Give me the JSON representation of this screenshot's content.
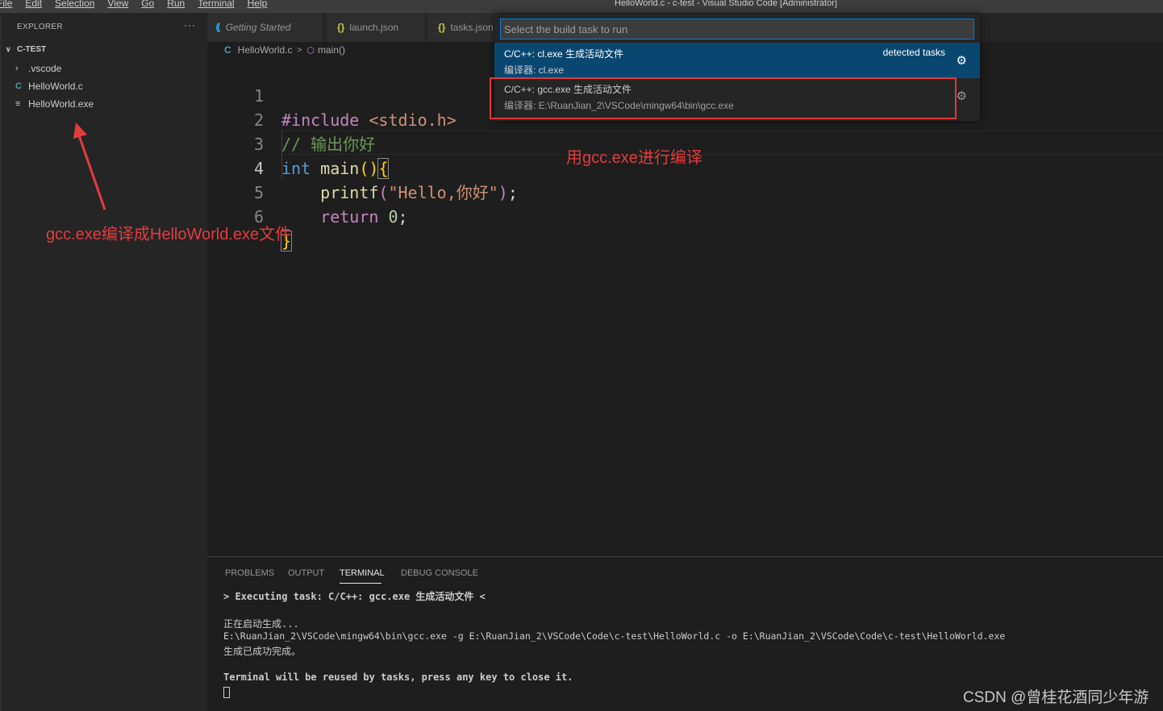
{
  "menu": [
    "File",
    "Edit",
    "Selection",
    "View",
    "Go",
    "Run",
    "Terminal",
    "Help"
  ],
  "window_title": "HelloWorld.c - c-test - Visual Studio Code [Administrator]",
  "explorer": {
    "header": "EXPLORER",
    "more": "···",
    "root": "C-TEST",
    "items": [
      {
        "icon": "chevron-right-icon",
        "label": ".vscode"
      },
      {
        "icon": "c-file-icon",
        "label": "HelloWorld.c"
      },
      {
        "icon": "exe-file-icon",
        "label": "HelloWorld.exe"
      }
    ]
  },
  "tabs": [
    {
      "label": "Getting Started",
      "icon": "vscode-icon"
    },
    {
      "label": "launch.json",
      "icon": "json-icon"
    },
    {
      "label": "tasks.json",
      "icon": "json-icon"
    }
  ],
  "breadcrumb": {
    "file": "HelloWorld.c",
    "symbol": "main()"
  },
  "code": {
    "line_numbers": [
      "1",
      "2",
      "3",
      "4",
      "5",
      "6"
    ],
    "l1_directive": "#include",
    "l1_header": "<stdio.h>",
    "l2_comment": "// 输出你好",
    "l3_type": "int",
    "l3_fn": "main",
    "l3_parens": "()",
    "l3_brace": "{",
    "l4_fn": "printf",
    "l4_open": "(",
    "l4_str": "\"Hello,你好\"",
    "l4_close": ")",
    "l4_semi": ";",
    "l5_kw": "return",
    "l5_num": "0",
    "l5_semi": ";",
    "l6_brace": "}"
  },
  "quick_pick": {
    "placeholder": "Select the build task to run",
    "items": [
      {
        "title": "C/C++: cl.exe 生成活动文件",
        "desc": "编译器: cl.exe",
        "tag": "detected tasks"
      },
      {
        "title": "C/C++: gcc.exe 生成活动文件",
        "desc": "编译器: E:\\RuanJian_2\\VSCode\\mingw64\\bin\\gcc.exe"
      }
    ]
  },
  "annotations": {
    "explorer_note": "gcc.exe编译成HelloWorld.exe文件",
    "gcc_note": "用gcc.exe进行编译"
  },
  "panel": {
    "tabs": [
      "PROBLEMS",
      "OUTPUT",
      "TERMINAL",
      "DEBUG CONSOLE"
    ],
    "active_tab": "TERMINAL",
    "terminal": [
      "> Executing task: C/C++: gcc.exe 生成活动文件 <",
      "正在启动生成...",
      "E:\\RuanJian_2\\VSCode\\mingw64\\bin\\gcc.exe -g E:\\RuanJian_2\\VSCode\\Code\\c-test\\HelloWorld.c -o E:\\RuanJian_2\\VSCode\\Code\\c-test\\HelloWorld.exe",
      "生成已成功完成。",
      "Terminal will be reused by tasks, press any key to close it."
    ]
  },
  "watermark": "CSDN @曾桂花酒同少年游",
  "colors": {
    "accent": "#007fd4",
    "selection": "#094771",
    "annotation": "#e33c3c"
  }
}
